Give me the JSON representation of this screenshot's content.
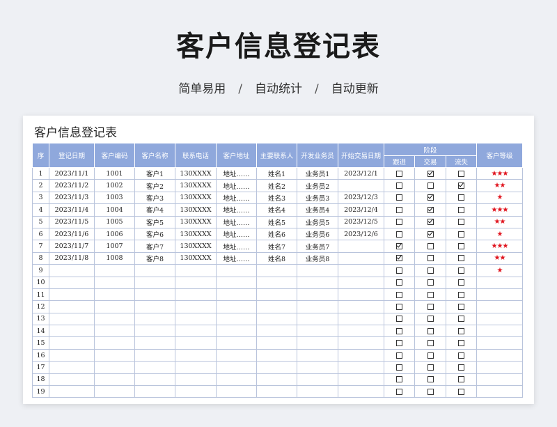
{
  "page_title": "客户信息登记表",
  "subtitle": {
    "items": [
      "简单易用",
      "自动统计",
      "自动更新"
    ],
    "separator": "/"
  },
  "sheet_title": "客户信息登记表",
  "headers": {
    "seq": "序",
    "date": "登记日期",
    "code": "客户编码",
    "name": "客户名称",
    "phone": "联系电话",
    "address": "客户地址",
    "contact": "主要联系人",
    "sales": "开发业务员",
    "start": "开始交易日期",
    "stage": "阶段",
    "follow": "跟进",
    "deal": "交易",
    "lost": "流失",
    "level": "客户等级"
  },
  "colors": {
    "header_bg": "#8fa8dc",
    "star": "#e0141e",
    "grid": "#b9c4dc"
  },
  "rows": [
    {
      "seq": "1",
      "date": "2023/11/1",
      "code": "1001",
      "name": "客户1",
      "phone": "130XXXX",
      "address": "地址……",
      "contact": "姓名1",
      "sales": "业务员1",
      "start": "2023/12/1",
      "follow": false,
      "deal": true,
      "lost": false,
      "stars": "★★★"
    },
    {
      "seq": "2",
      "date": "2023/11/2",
      "code": "1002",
      "name": "客户2",
      "phone": "130XXXX",
      "address": "地址……",
      "contact": "姓名2",
      "sales": "业务员2",
      "start": "",
      "follow": false,
      "deal": false,
      "lost": true,
      "stars": "★★"
    },
    {
      "seq": "3",
      "date": "2023/11/3",
      "code": "1003",
      "name": "客户3",
      "phone": "130XXXX",
      "address": "地址……",
      "contact": "姓名3",
      "sales": "业务员3",
      "start": "2023/12/3",
      "follow": false,
      "deal": true,
      "lost": false,
      "stars": "★"
    },
    {
      "seq": "4",
      "date": "2023/11/4",
      "code": "1004",
      "name": "客户4",
      "phone": "130XXXX",
      "address": "地址……",
      "contact": "姓名4",
      "sales": "业务员4",
      "start": "2023/12/4",
      "follow": false,
      "deal": true,
      "lost": false,
      "stars": "★★★"
    },
    {
      "seq": "5",
      "date": "2023/11/5",
      "code": "1005",
      "name": "客户5",
      "phone": "130XXXX",
      "address": "地址……",
      "contact": "姓名5",
      "sales": "业务员5",
      "start": "2023/12/5",
      "follow": false,
      "deal": true,
      "lost": false,
      "stars": "★★"
    },
    {
      "seq": "6",
      "date": "2023/11/6",
      "code": "1006",
      "name": "客户6",
      "phone": "130XXXX",
      "address": "地址……",
      "contact": "姓名6",
      "sales": "业务员6",
      "start": "2023/12/6",
      "follow": false,
      "deal": true,
      "lost": false,
      "stars": "★"
    },
    {
      "seq": "7",
      "date": "2023/11/7",
      "code": "1007",
      "name": "客户7",
      "phone": "130XXXX",
      "address": "地址……",
      "contact": "姓名7",
      "sales": "业务员7",
      "start": "",
      "follow": true,
      "deal": false,
      "lost": false,
      "stars": "★★★"
    },
    {
      "seq": "8",
      "date": "2023/11/8",
      "code": "1008",
      "name": "客户8",
      "phone": "130XXXX",
      "address": "地址……",
      "contact": "姓名8",
      "sales": "业务员8",
      "start": "",
      "follow": true,
      "deal": false,
      "lost": false,
      "stars": "★★"
    },
    {
      "seq": "9",
      "date": "",
      "code": "",
      "name": "",
      "phone": "",
      "address": "",
      "contact": "",
      "sales": "",
      "start": "",
      "follow": false,
      "deal": false,
      "lost": false,
      "stars": "★"
    },
    {
      "seq": "10",
      "date": "",
      "code": "",
      "name": "",
      "phone": "",
      "address": "",
      "contact": "",
      "sales": "",
      "start": "",
      "follow": false,
      "deal": false,
      "lost": false,
      "stars": ""
    },
    {
      "seq": "11",
      "date": "",
      "code": "",
      "name": "",
      "phone": "",
      "address": "",
      "contact": "",
      "sales": "",
      "start": "",
      "follow": false,
      "deal": false,
      "lost": false,
      "stars": ""
    },
    {
      "seq": "12",
      "date": "",
      "code": "",
      "name": "",
      "phone": "",
      "address": "",
      "contact": "",
      "sales": "",
      "start": "",
      "follow": false,
      "deal": false,
      "lost": false,
      "stars": ""
    },
    {
      "seq": "13",
      "date": "",
      "code": "",
      "name": "",
      "phone": "",
      "address": "",
      "contact": "",
      "sales": "",
      "start": "",
      "follow": false,
      "deal": false,
      "lost": false,
      "stars": ""
    },
    {
      "seq": "14",
      "date": "",
      "code": "",
      "name": "",
      "phone": "",
      "address": "",
      "contact": "",
      "sales": "",
      "start": "",
      "follow": false,
      "deal": false,
      "lost": false,
      "stars": ""
    },
    {
      "seq": "15",
      "date": "",
      "code": "",
      "name": "",
      "phone": "",
      "address": "",
      "contact": "",
      "sales": "",
      "start": "",
      "follow": false,
      "deal": false,
      "lost": false,
      "stars": ""
    },
    {
      "seq": "16",
      "date": "",
      "code": "",
      "name": "",
      "phone": "",
      "address": "",
      "contact": "",
      "sales": "",
      "start": "",
      "follow": false,
      "deal": false,
      "lost": false,
      "stars": ""
    },
    {
      "seq": "17",
      "date": "",
      "code": "",
      "name": "",
      "phone": "",
      "address": "",
      "contact": "",
      "sales": "",
      "start": "",
      "follow": false,
      "deal": false,
      "lost": false,
      "stars": ""
    },
    {
      "seq": "18",
      "date": "",
      "code": "",
      "name": "",
      "phone": "",
      "address": "",
      "contact": "",
      "sales": "",
      "start": "",
      "follow": false,
      "deal": false,
      "lost": false,
      "stars": ""
    },
    {
      "seq": "19",
      "date": "",
      "code": "",
      "name": "",
      "phone": "",
      "address": "",
      "contact": "",
      "sales": "",
      "start": "",
      "follow": false,
      "deal": false,
      "lost": false,
      "stars": ""
    }
  ]
}
